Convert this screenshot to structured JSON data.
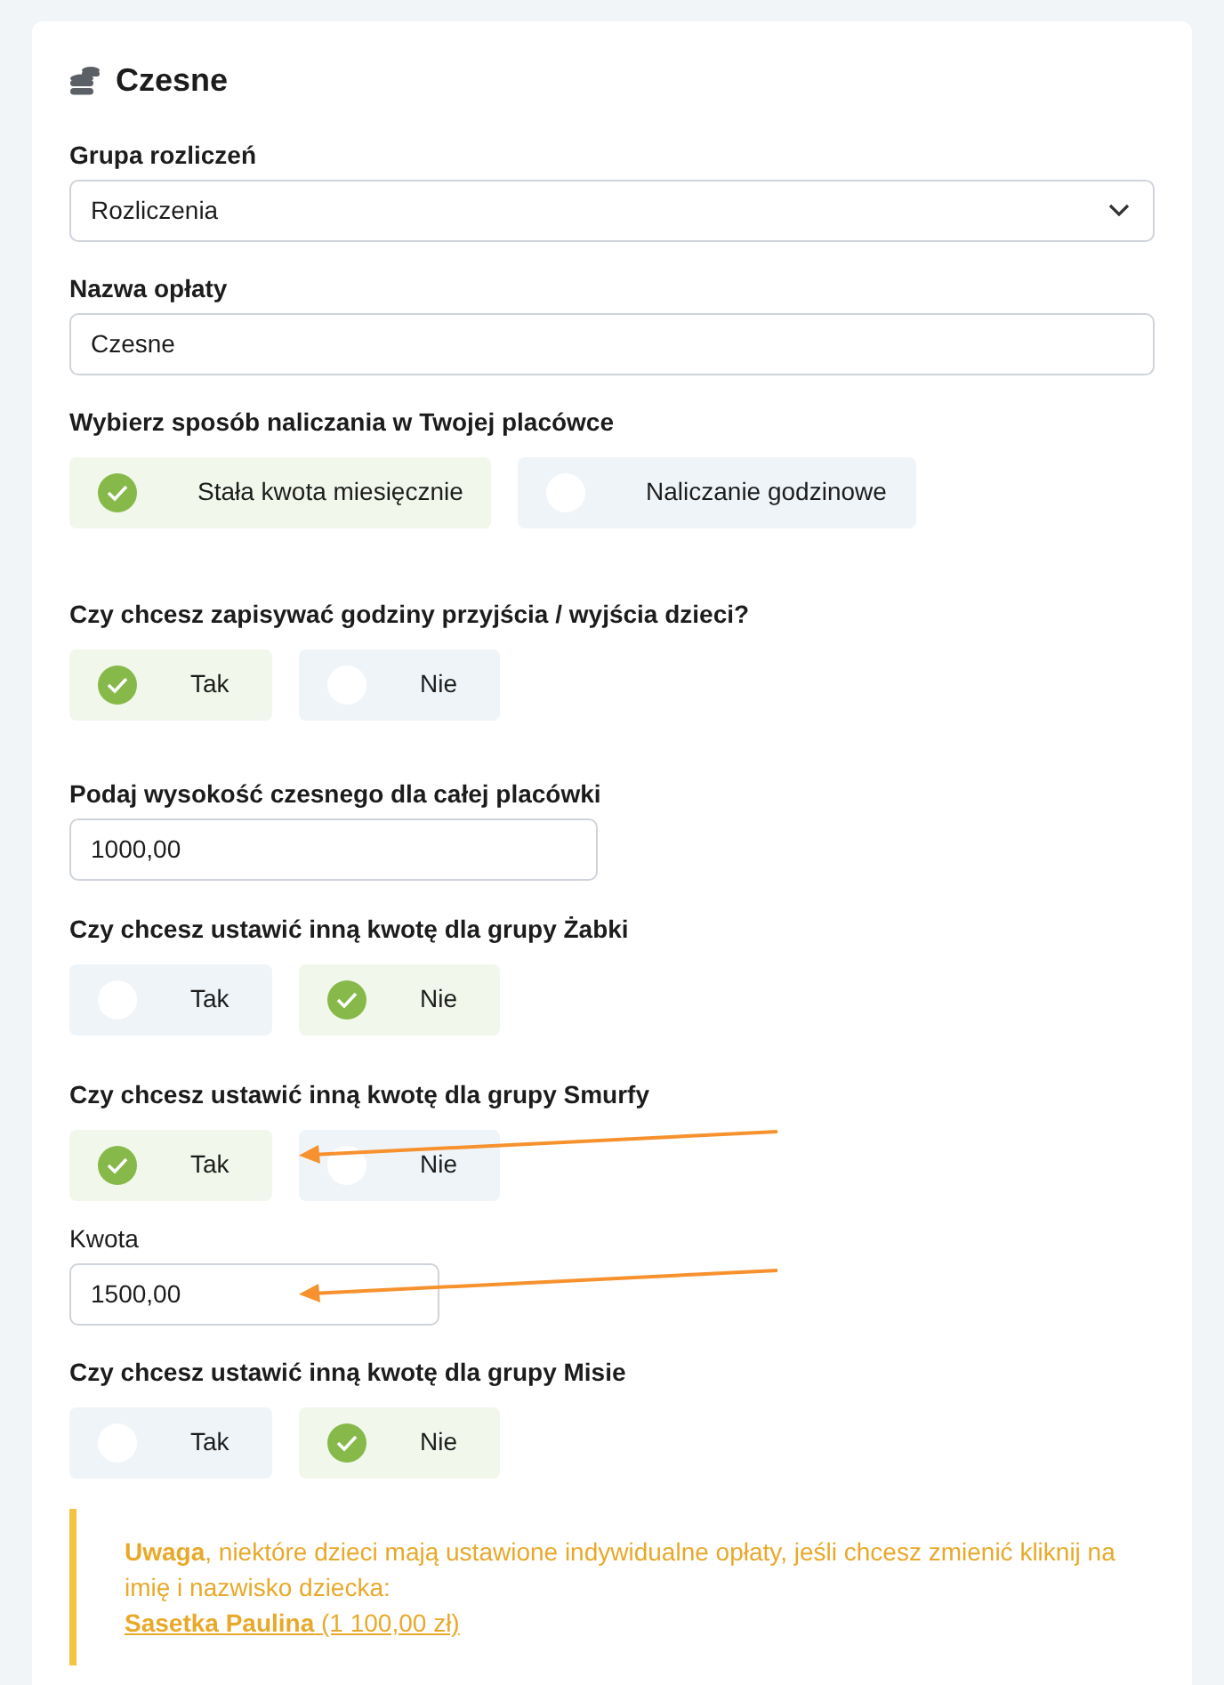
{
  "title": "Czesne",
  "fields": [
    {
      "kind": "select",
      "label": "Grupa rozliczeń",
      "value": "Rozliczenia"
    },
    {
      "kind": "text",
      "label": "Nazwa opłaty",
      "value": "Czesne"
    },
    {
      "kind": "choice",
      "label": "Wybierz sposób naliczania w Twojej placówce",
      "options": [
        {
          "label": "Stała kwota miesięcznie",
          "selected": true
        },
        {
          "label": "Naliczanie godzinowe",
          "selected": false
        }
      ]
    },
    {
      "kind": "choice",
      "label": "Czy chcesz zapisywać godziny przyjścia / wyjścia dzieci?",
      "options": [
        {
          "label": "Tak",
          "selected": true
        },
        {
          "label": "Nie",
          "selected": false
        }
      ]
    },
    {
      "kind": "amount",
      "label": "Podaj wysokość czesnego dla całej placówki",
      "value": "1000,00"
    },
    {
      "kind": "choice",
      "label": "Czy chcesz ustawić inną kwotę dla grupy Żabki",
      "options": [
        {
          "label": "Tak",
          "selected": false
        },
        {
          "label": "Nie",
          "selected": true
        }
      ]
    },
    {
      "kind": "choice",
      "label": "Czy chcesz ustawić inną kwotę dla grupy Smurfy",
      "arrow": true,
      "options": [
        {
          "label": "Tak",
          "selected": true
        },
        {
          "label": "Nie",
          "selected": false
        }
      ]
    },
    {
      "kind": "subamount",
      "label": "Kwota",
      "value": "1500,00",
      "arrow": true
    },
    {
      "kind": "choice",
      "label": "Czy chcesz ustawić inną kwotę dla grupy Misie",
      "options": [
        {
          "label": "Tak",
          "selected": false
        },
        {
          "label": "Nie",
          "selected": true
        }
      ]
    }
  ],
  "notice": {
    "text": "**Uwaga**, niektóre dzieci mają ustawione indywidualne opłaty, jeśli chcesz zmienić kliknij na imię i nazwisko dziecka:",
    "link": "**Sasetka Paulina** (1 100,00 zł)"
  }
}
